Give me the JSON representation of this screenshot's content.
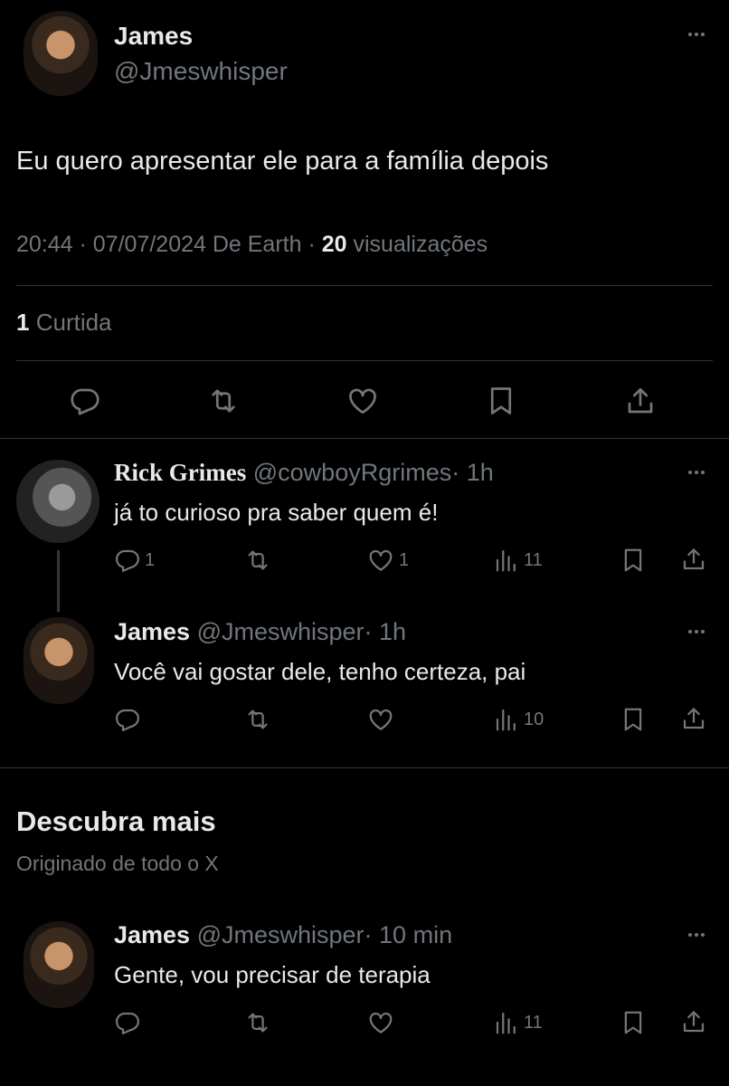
{
  "main_tweet": {
    "name": "James",
    "handle": "@Jmeswhisper",
    "text": "Eu quero apresentar ele para a família depois",
    "time_date": "20:44 · 07/07/2024 De Earth ·",
    "views_count": "20",
    "views_label": "visualizações",
    "likes_count": "1",
    "likes_label": "Curtida"
  },
  "replies": [
    {
      "name": "Rick Grimes",
      "handle": "@cowboyRgrimes",
      "time": "· 1h",
      "text": "já to curioso pra saber quem é!",
      "reply_count": "1",
      "like_count": "1",
      "view_count": "11"
    },
    {
      "name": "James",
      "handle": "@Jmeswhisper",
      "time": "· 1h",
      "text": "Você vai gostar dele, tenho certeza, pai",
      "reply_count": "",
      "like_count": "",
      "view_count": "10"
    }
  ],
  "discover": {
    "title": "Descubra mais",
    "subtitle": "Originado de todo o X"
  },
  "discover_tweet": {
    "name": "James",
    "handle": "@Jmeswhisper",
    "time": "· 10 min",
    "text": "Gente, vou precisar de terapia",
    "view_count": "11"
  },
  "icons": [
    "more-icon",
    "reply-icon",
    "retweet-icon",
    "like-icon",
    "bookmark-icon",
    "share-icon",
    "views-icon"
  ],
  "colors": {
    "background": "#000000",
    "text": "#e7e9ea",
    "muted": "#71767b",
    "divider": "#2f3336"
  }
}
